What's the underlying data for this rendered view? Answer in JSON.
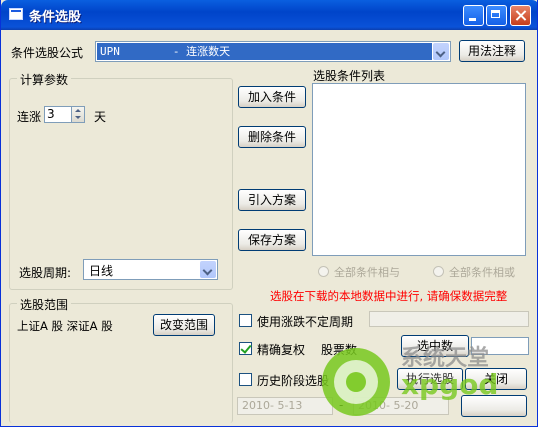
{
  "window": {
    "title": "条件选股"
  },
  "formula": {
    "label": "条件选股公式",
    "selected": "UPN        - 连涨数天",
    "help_button": "用法注释"
  },
  "params": {
    "group_title": "计算参数",
    "prefix": "连涨",
    "value": "3",
    "suffix": "天",
    "period_label": "选股周期:",
    "period_value": "日线"
  },
  "actions": {
    "add": "加入条件",
    "delete": "删除条件",
    "import": "引入方案",
    "save": "保存方案"
  },
  "condition_list": {
    "title": "选股条件列表",
    "items": []
  },
  "logic": {
    "and_label": "全部条件相与",
    "or_label": "全部条件相或"
  },
  "warning": "选股在下载的本地数据中进行, 请确保数据完整",
  "range": {
    "group_title": "选股范围",
    "markets": "上证A 股 深证A 股",
    "change_button": "改变范围"
  },
  "options": {
    "use_suspended_label": "使用涨跌不定周期",
    "use_suspended_checked": false,
    "adjust_label": "精确复权",
    "adjust_checked": true,
    "count_label": "股票数",
    "select_button": "选中数",
    "history_label": "历史阶段选股",
    "history_checked": false,
    "date_from": "2010- 5-13",
    "date_to": "2010- 5-20",
    "run_button": "执行选股",
    "close_button": "关闭"
  },
  "watermark": {
    "cn": "系统天堂",
    "en": "xpgod"
  },
  "colors": {
    "titlebar": "#0a5fe0",
    "selection": "#316ac5",
    "warning": "#ff0000",
    "face": "#ece9d8"
  }
}
